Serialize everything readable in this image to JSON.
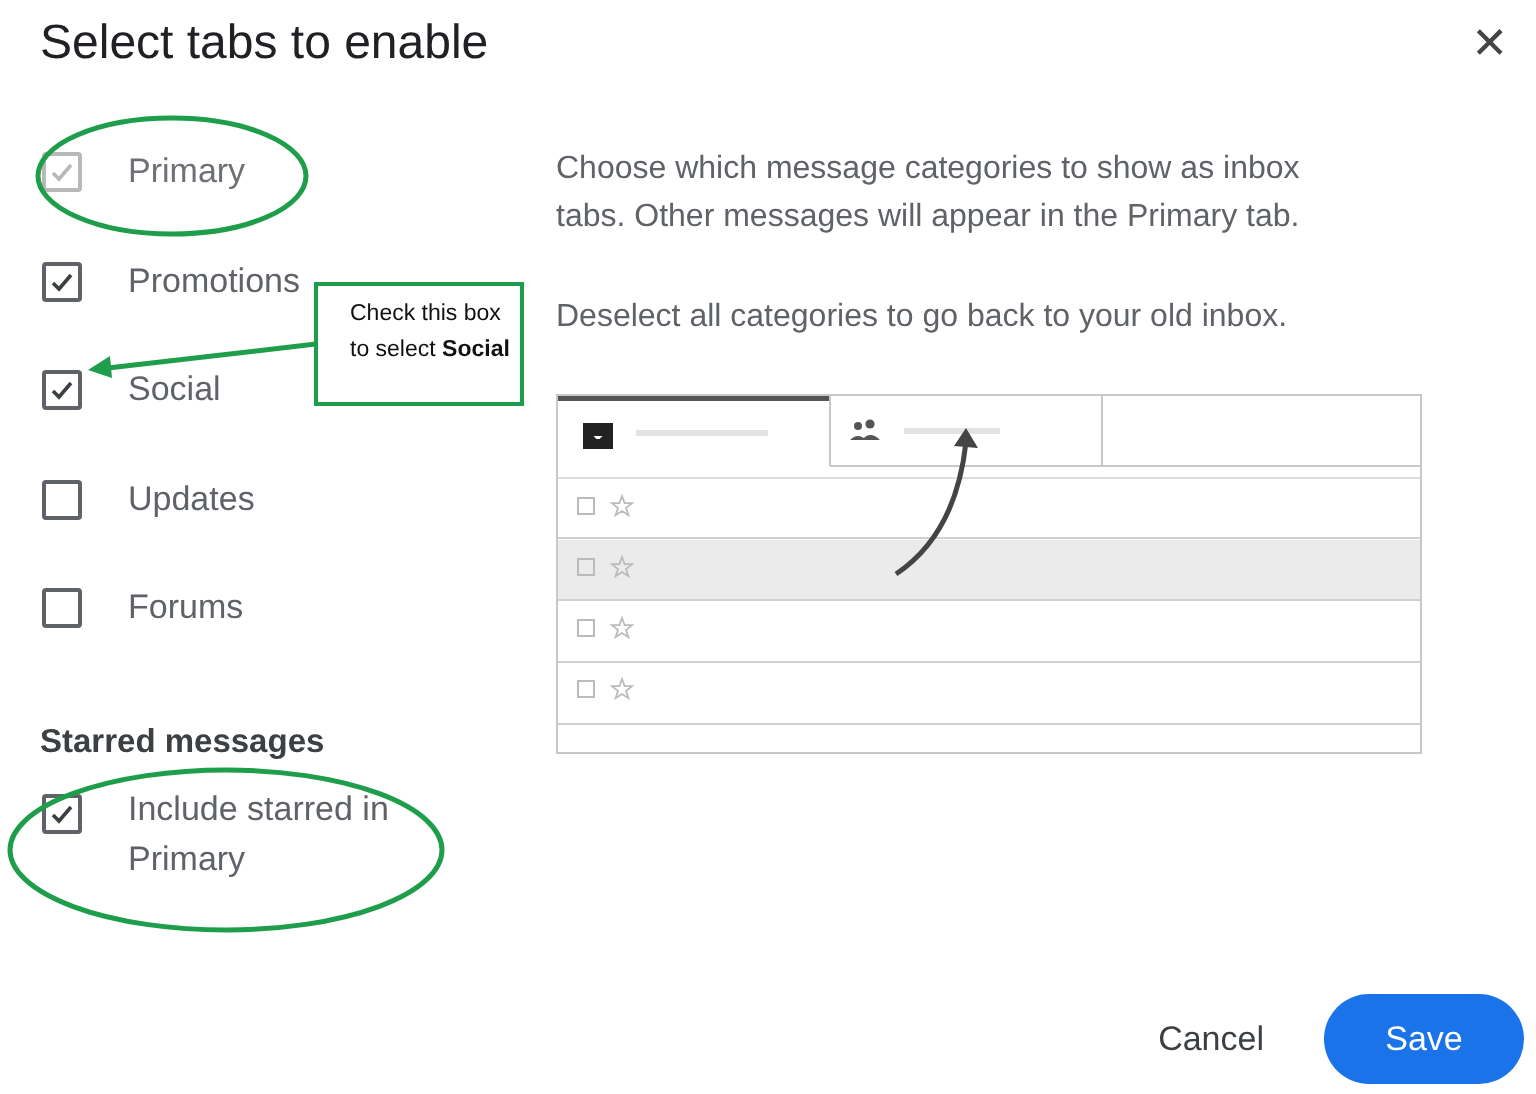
{
  "dialog": {
    "title": "Select tabs to enable",
    "close": "✕"
  },
  "categories": [
    {
      "label": "Primary",
      "checked": true,
      "disabled": true
    },
    {
      "label": "Promotions",
      "checked": true,
      "disabled": false
    },
    {
      "label": "Social",
      "checked": true,
      "disabled": false
    },
    {
      "label": "Updates",
      "checked": false,
      "disabled": false
    },
    {
      "label": "Forums",
      "checked": false,
      "disabled": false
    }
  ],
  "starred": {
    "heading": "Starred messages",
    "option": {
      "label": "Include starred in Primary",
      "checked": true
    }
  },
  "description": [
    "Choose which message categories to show as inbox tabs. Other messages will appear in the Primary tab.",
    "Deselect all categories to go back to your old inbox."
  ],
  "annotation": {
    "callout": "Check this box to select **Social**"
  },
  "buttons": {
    "cancel": "Cancel",
    "save": "Save"
  }
}
